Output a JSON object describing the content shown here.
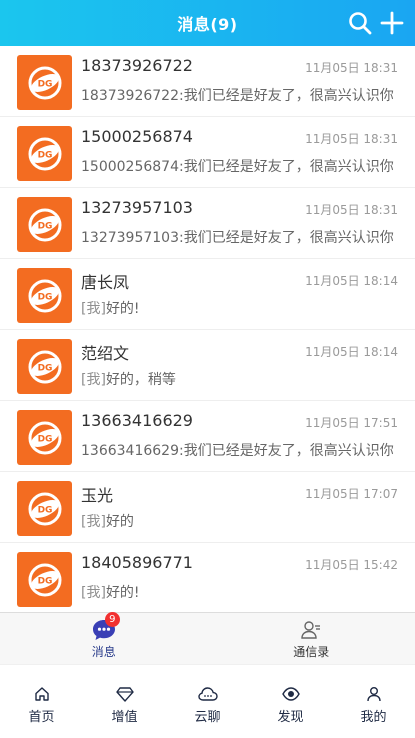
{
  "header": {
    "title": "消息(9)"
  },
  "conversations": [
    {
      "name": "18373926722",
      "time": "11月05日 18:31",
      "prefix": "",
      "message": "18373926722:我们已经是好友了，很高兴认识你"
    },
    {
      "name": "15000256874",
      "time": "11月05日 18:31",
      "prefix": "",
      "message": "15000256874:我们已经是好友了，很高兴认识你"
    },
    {
      "name": "13273957103",
      "time": "11月05日 18:31",
      "prefix": "",
      "message": "13273957103:我们已经是好友了，很高兴认识你"
    },
    {
      "name": "唐长凤",
      "time": "11月05日 18:14",
      "prefix": "[我]",
      "message": "好的!"
    },
    {
      "name": "范绍文",
      "time": "11月05日 18:14",
      "prefix": "[我]",
      "message": "好的，稍等"
    },
    {
      "name": "13663416629",
      "time": "11月05日 17:51",
      "prefix": "",
      "message": "13663416629:我们已经是好友了，很高兴认识你"
    },
    {
      "name": "玉光",
      "time": "11月05日 17:07",
      "prefix": "[我]",
      "message": "好的"
    },
    {
      "name": "18405896771",
      "time": "11月05日 15:42",
      "prefix": "[我]",
      "message": "好的!"
    }
  ],
  "subtabs": {
    "messages": {
      "label": "消息",
      "badge": "9"
    },
    "contacts": {
      "label": "通信录"
    }
  },
  "bottomnav": {
    "home": "首页",
    "value_added": "增值",
    "cloud_chat": "云聊",
    "discover": "发现",
    "mine": "我的"
  },
  "colors": {
    "header_start": "#1bc6ee",
    "header_end": "#1aa6f2",
    "avatar": "#f36c21",
    "badge": "#f23030",
    "active_tab": "#2c3e8c"
  }
}
